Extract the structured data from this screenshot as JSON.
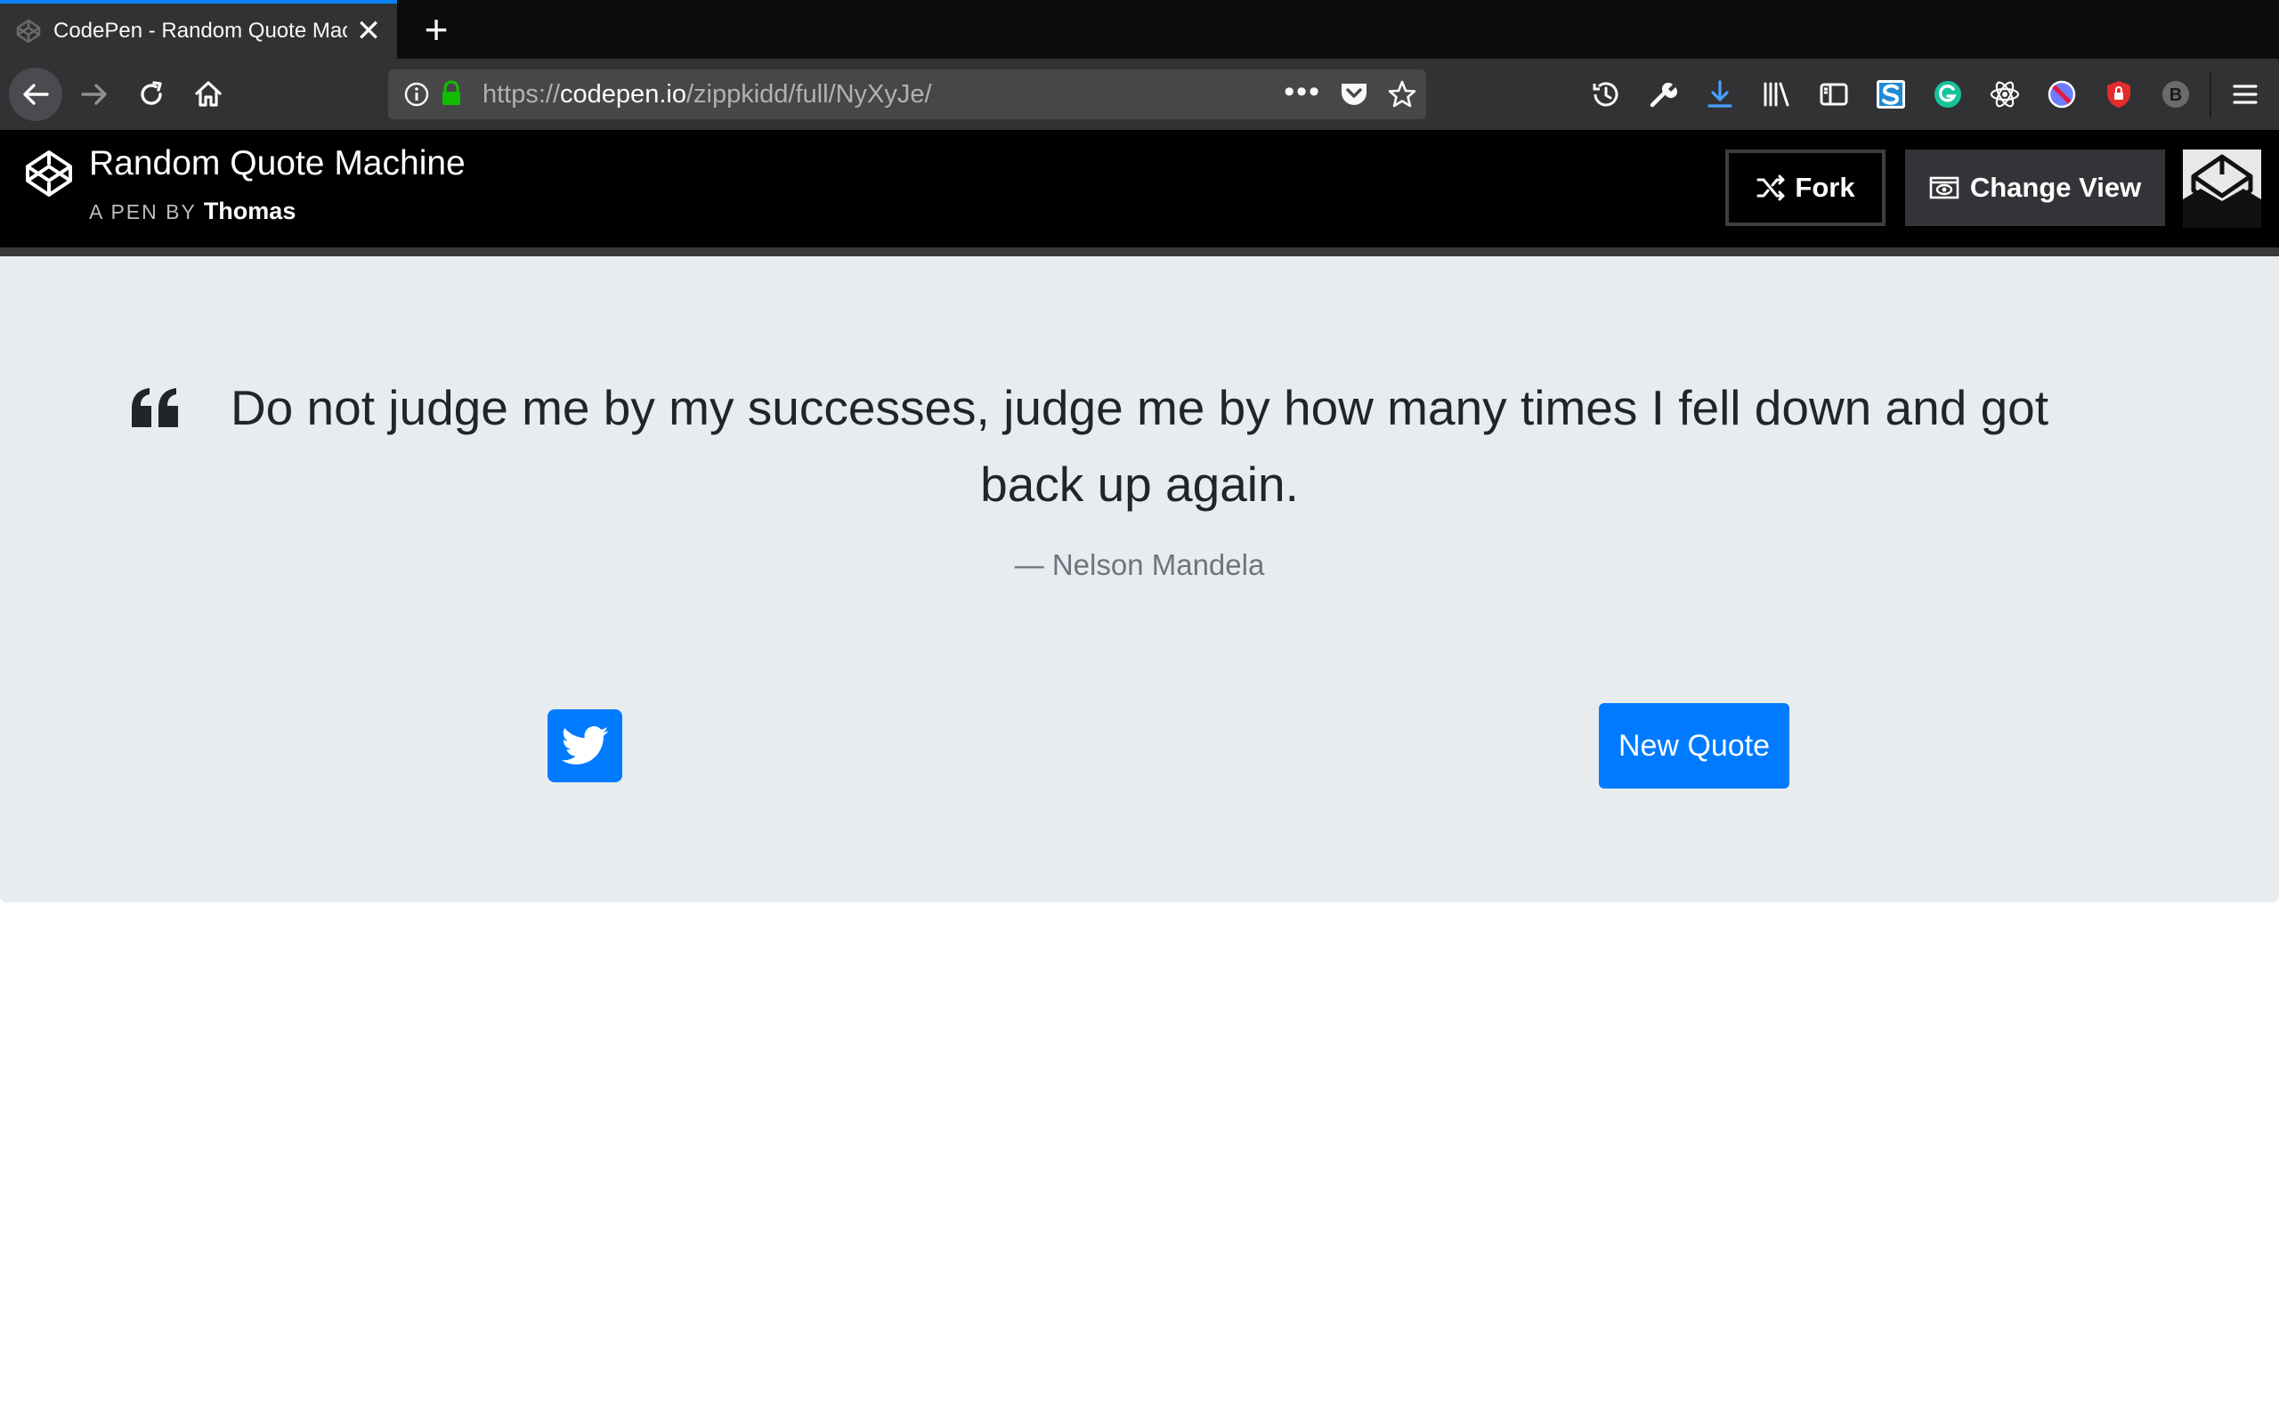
{
  "browser": {
    "tab": {
      "title": "CodePen - Random Quote Machine",
      "close_glyph": "✕"
    },
    "new_tab_glyph": "+",
    "url": {
      "scheme": "https://",
      "host": "codepen.io",
      "path": "/zippkidd/full/NyXyJe/"
    },
    "url_dots": "•••",
    "toolbar_icons": [
      "history-icon",
      "wrench-icon",
      "download-icon",
      "library-icon",
      "sidebar-icon",
      "stylus-extension-icon",
      "grammarly-extension-icon",
      "react-devtools-icon",
      "block-extension-icon",
      "privacy-badger-icon",
      "b-extension-icon",
      "hamburger-menu-icon"
    ],
    "accent_color": "#0a84ff"
  },
  "header": {
    "title": "Random Quote Machine",
    "byline_prefix": "A PEN BY",
    "author": "Thomas",
    "fork_label": "Fork",
    "change_view_label": "Change View"
  },
  "quote": {
    "text": "Do not judge me by my successes, judge me by how many times I fell down and got back up again.",
    "author": "— Nelson Mandela"
  },
  "actions": {
    "new_quote_label": "New Quote",
    "button_color": "#007bff"
  }
}
